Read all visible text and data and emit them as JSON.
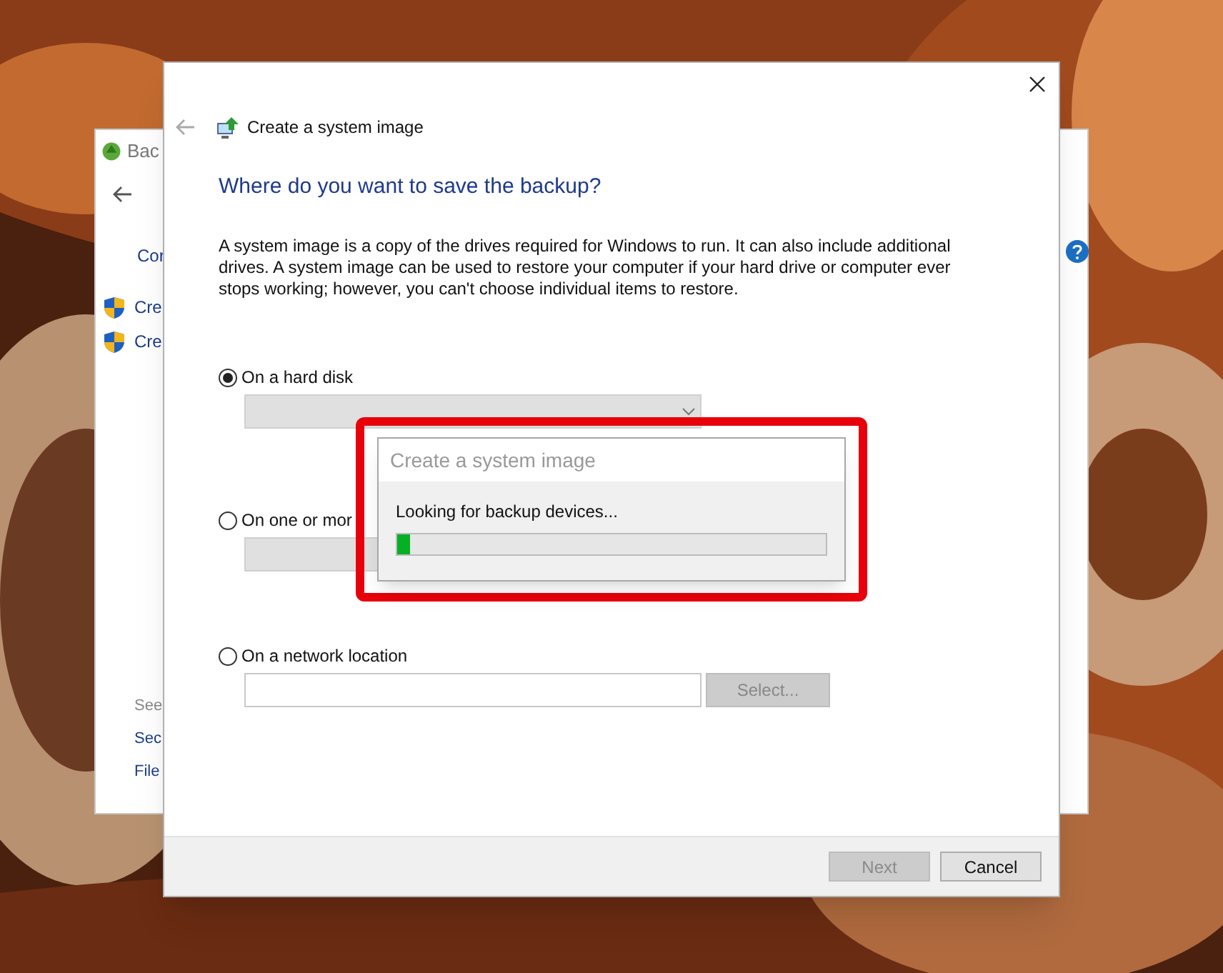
{
  "background_window": {
    "title": "Bac",
    "sidebar": [
      {
        "label": "Cor",
        "kind": "link"
      },
      {
        "label": "Cre",
        "kind": "shield"
      },
      {
        "label": "Cre",
        "kind": "shield"
      }
    ],
    "see_also": {
      "heading": "See",
      "links": [
        "Sec",
        "File"
      ]
    }
  },
  "dialog": {
    "title": "Create a system image",
    "heading": "Where do you want to save the backup?",
    "description": "A system image is a copy of the drives required for Windows to run. It can also include additional drives. A system image can be used to restore your computer if your hard drive or computer ever stops working; however, you can't choose individual items to restore.",
    "options": [
      {
        "label": "On a hard disk",
        "selected": true,
        "kind": "dropdown"
      },
      {
        "label": "On one or mor",
        "selected": false,
        "kind": "dropdown"
      },
      {
        "label": "On a network location",
        "selected": false,
        "kind": "path"
      }
    ],
    "select_button": "Select...",
    "buttons": [
      {
        "label": "Next",
        "disabled": true
      },
      {
        "label": "Cancel",
        "disabled": false
      }
    ]
  },
  "progress": {
    "title": "Create a system image",
    "message": "Looking for backup devices...",
    "level": 0.03
  }
}
